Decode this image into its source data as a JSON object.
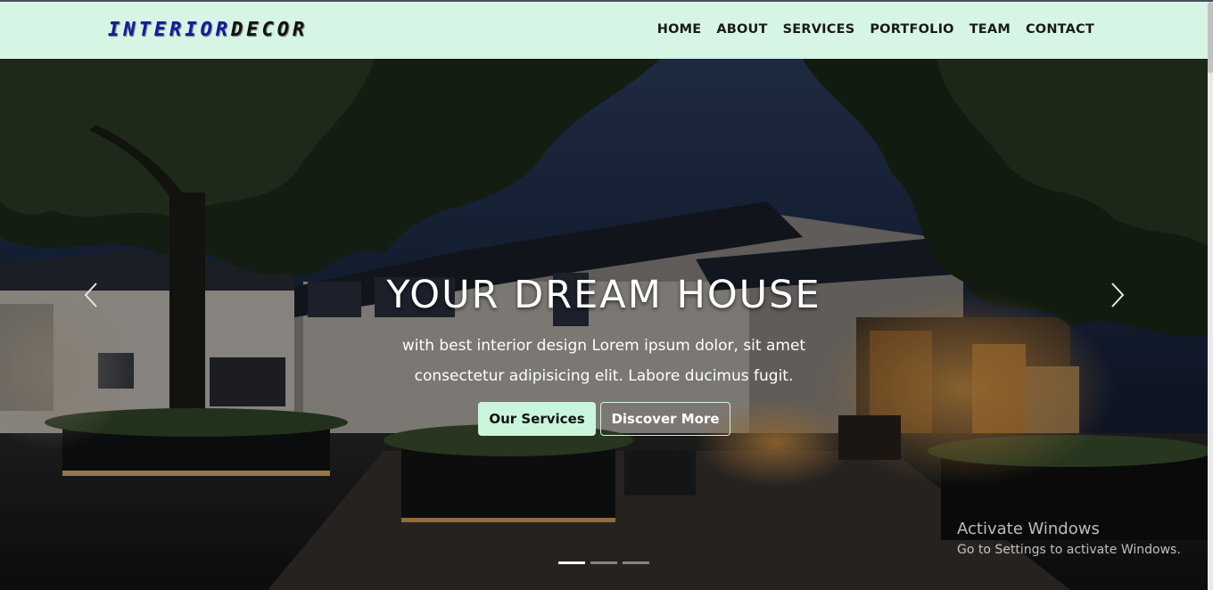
{
  "brand": {
    "part1": "INTERIOR",
    "part2": "DECOR"
  },
  "nav": {
    "home": "HOME",
    "about": "ABOUT",
    "services": "SERVICES",
    "portfolio": "PORTFOLIO",
    "team": "TEAM",
    "contact": "CONTACT"
  },
  "hero": {
    "title": "YOUR DREAM HOUSE",
    "subtitle_line1": "with best interior design Lorem ipsum dolor, sit amet",
    "subtitle_line2": "consectetur adipisicing elit. Labore ducimus fugit.",
    "btn_services": "Our Services",
    "btn_discover": "Discover More"
  },
  "carousel": {
    "slide_count": 3,
    "active_index": 0
  },
  "watermark": {
    "title": "Activate Windows",
    "sub": "Go to Settings to activate Windows."
  },
  "colors": {
    "navbar_bg": "#d6f5e5",
    "brand_accent": "#141a9e",
    "button_mint": "#c9f5da"
  },
  "icons": {
    "prev": "chevron-left-icon",
    "next": "chevron-right-icon"
  }
}
